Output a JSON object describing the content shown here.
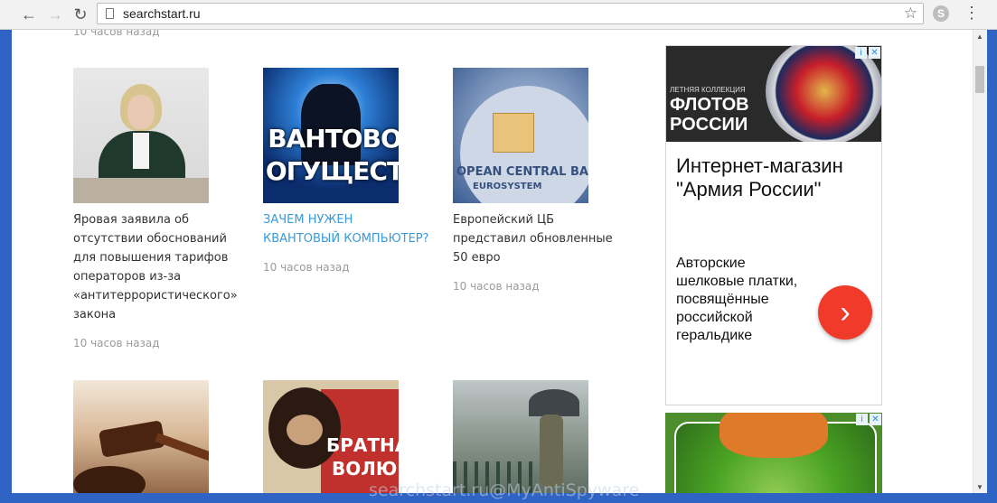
{
  "browser": {
    "url": "searchstart.ru",
    "back_icon": "←",
    "forward_icon": "→",
    "reload_icon": "↻",
    "star_icon": "☆",
    "menu_icon": "⋮"
  },
  "feed": {
    "prev_time": "10 часов назад",
    "cards": [
      {
        "title": "Яровая заявила об отсутствии обоснований для повышения тарифов операторов из-за «антитеррористического» закона",
        "time": "10 часов назад"
      },
      {
        "title": "ЗАЧЕМ НУЖЕН КВАНТОВЫЙ КОМПЬЮТЕР?",
        "time": "10 часов назад",
        "thumb_text_1": "ВАНТОВО",
        "thumb_text_2": "ОГУЩЕСТ"
      },
      {
        "title": "Европейский ЦБ представил обновленные 50 евро",
        "time": "10 часов назад",
        "thumb_text_1": "OPEAN CENTRAL BA",
        "thumb_text_2": "EUROSYSTEM"
      }
    ],
    "row2": [
      {
        "thumb_text": ""
      },
      {
        "thumb_text_1": "БРАТНА",
        "thumb_text_2": "ВОЛЮЦ"
      },
      {
        "thumb_text": ""
      }
    ]
  },
  "ads": {
    "ad1": {
      "banner_tag": "ЛЕТНЯЯ КОЛЛЕКЦИЯ",
      "banner_title": "ФЛОТОВ РОССИИ",
      "headline": "Интернет-магазин \"Армия России\"",
      "body": "Авторские шелковые платки, посвящённые российской геральдике",
      "go_label": "›",
      "info_icon": "i",
      "close_icon": "✕"
    },
    "ad2": {
      "info_icon": "i",
      "close_icon": "✕"
    }
  },
  "watermark": "searchstart.ru@MyAntiSpyware"
}
